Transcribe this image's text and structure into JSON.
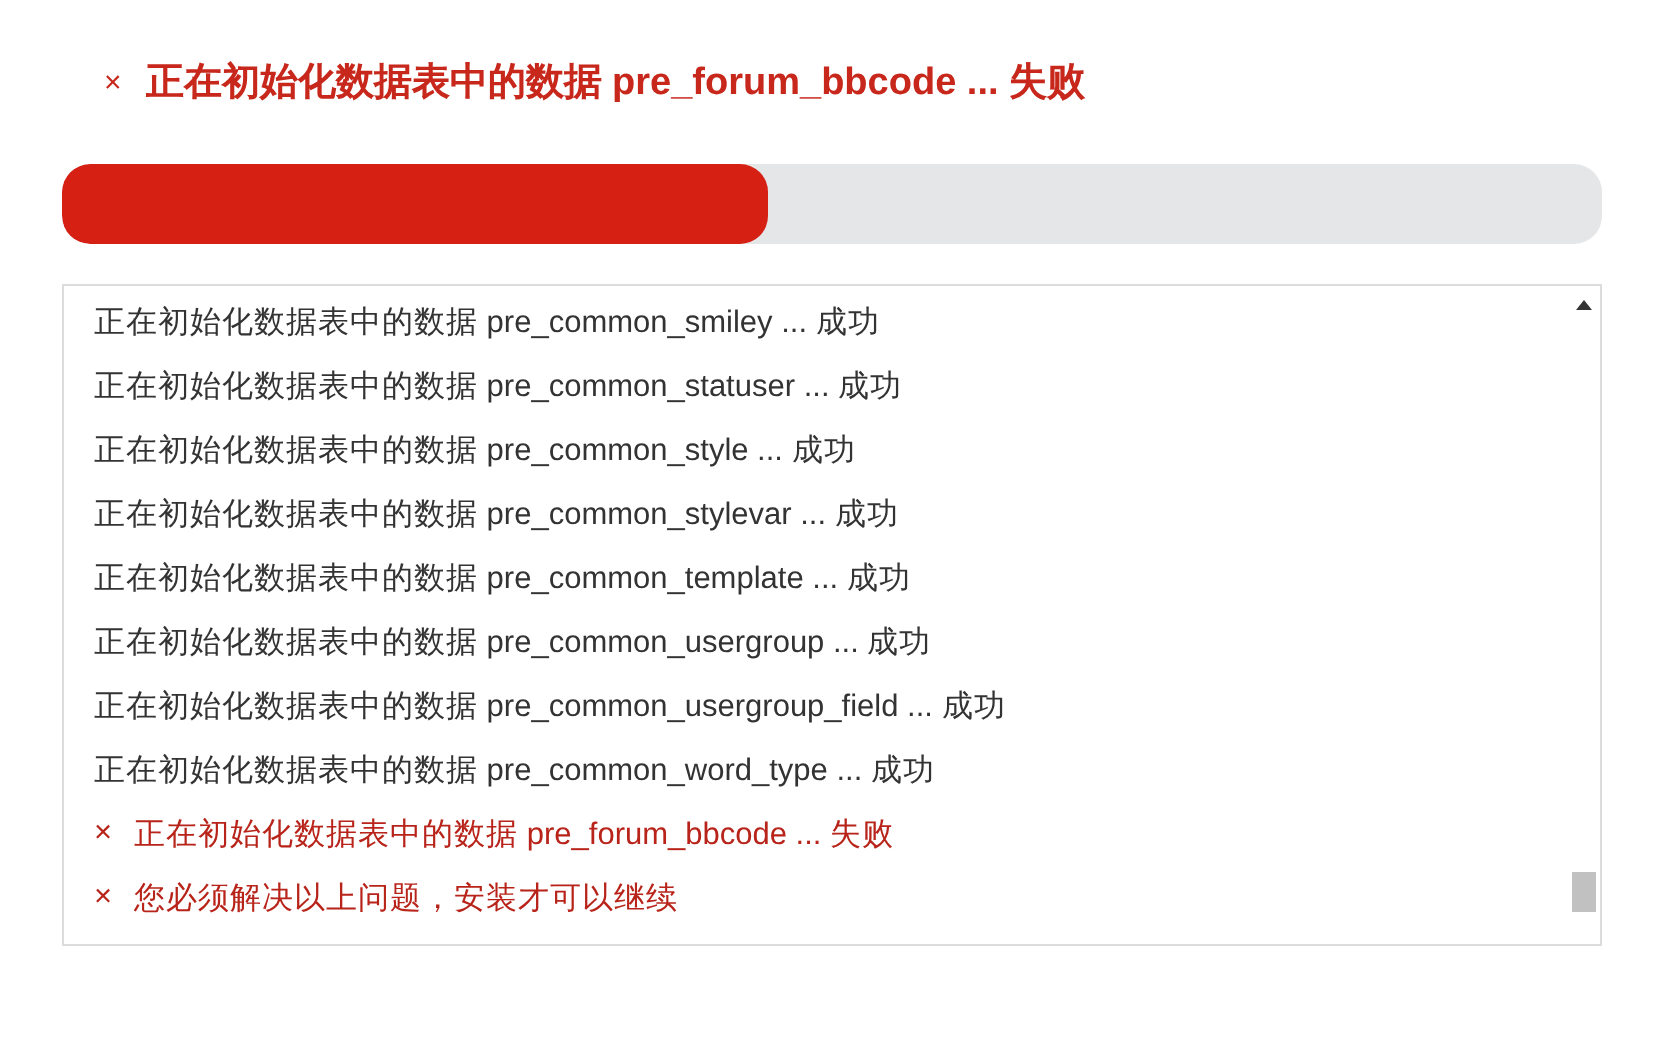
{
  "status": {
    "kind": "error",
    "mark": "×",
    "text": "正在初始化数据表中的数据 pre_forum_bbcode ... 失败"
  },
  "progress": {
    "level": 0.458
  },
  "log": [
    {
      "kind": "success",
      "text": "正在初始化数据表中的数据 pre_common_smiley ... 成功"
    },
    {
      "kind": "success",
      "text": "正在初始化数据表中的数据 pre_common_statuser ... 成功"
    },
    {
      "kind": "success",
      "text": "正在初始化数据表中的数据 pre_common_style ... 成功"
    },
    {
      "kind": "success",
      "text": "正在初始化数据表中的数据 pre_common_stylevar ... 成功"
    },
    {
      "kind": "success",
      "text": "正在初始化数据表中的数据 pre_common_template ... 成功"
    },
    {
      "kind": "success",
      "text": "正在初始化数据表中的数据 pre_common_usergroup ... 成功"
    },
    {
      "kind": "success",
      "text": "正在初始化数据表中的数据 pre_common_usergroup_field ... 成功"
    },
    {
      "kind": "success",
      "text": "正在初始化数据表中的数据 pre_common_word_type ... 成功"
    },
    {
      "kind": "error",
      "mark": "×",
      "text": "正在初始化数据表中的数据 pre_forum_bbcode ... 失败"
    },
    {
      "kind": "error",
      "mark": "×",
      "text": "您必须解决以上问题，安装才可以继续"
    }
  ]
}
